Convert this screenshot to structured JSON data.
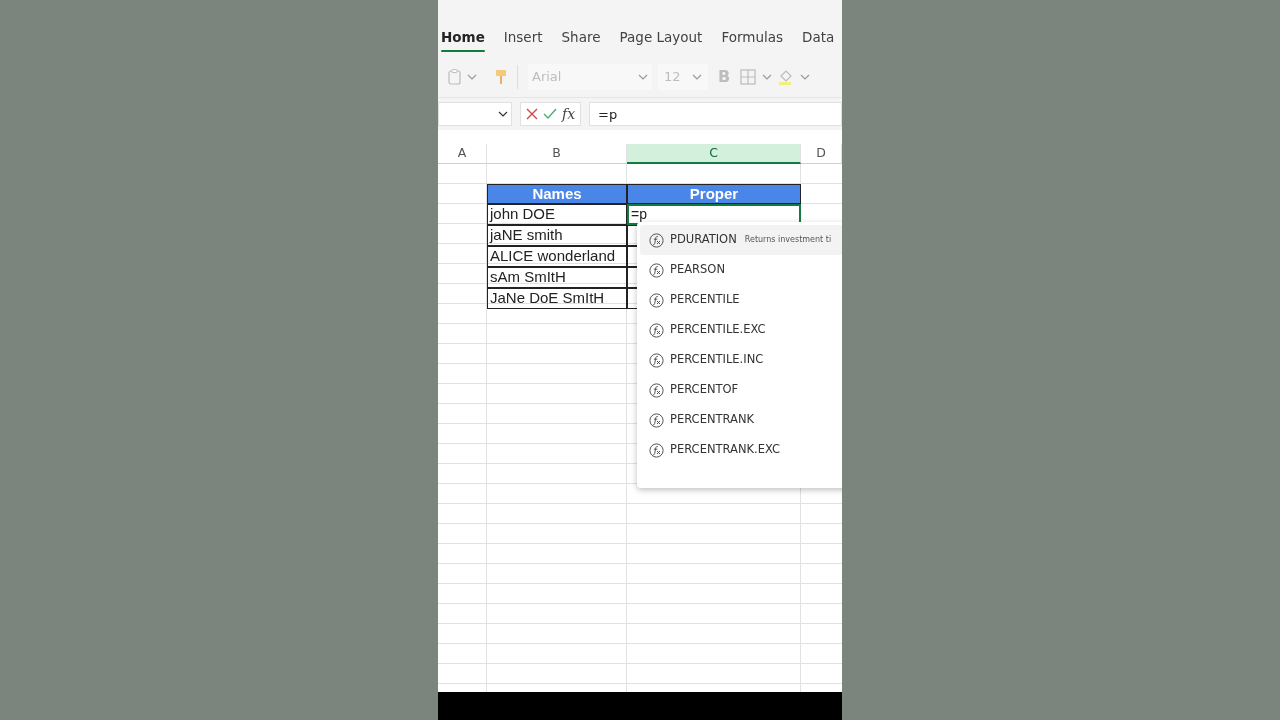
{
  "ribbon_tabs": [
    {
      "label": "Home",
      "selected": true
    },
    {
      "label": "Insert",
      "selected": false
    },
    {
      "label": "Share",
      "selected": false
    },
    {
      "label": "Page Layout",
      "selected": false
    },
    {
      "label": "Formulas",
      "selected": false
    },
    {
      "label": "Data",
      "selected": false
    }
  ],
  "toolbar": {
    "font": "Arial",
    "font_size": "12",
    "bold_label": "B"
  },
  "formula_bar": {
    "function_label": "fx",
    "value": "=p"
  },
  "columns": [
    {
      "label": "A",
      "selected": false
    },
    {
      "label": "B",
      "selected": false
    },
    {
      "label": "C",
      "selected": true
    },
    {
      "label": "D",
      "selected": false
    }
  ],
  "table": {
    "headers": [
      "Names",
      "Proper"
    ],
    "rows": [
      {
        "name": "john DOE",
        "proper": "=p",
        "active": true
      },
      {
        "name": "jaNE smith",
        "active": false
      },
      {
        "name": "ALICE wonderland",
        "active": false
      },
      {
        "name": "sAm SmItH",
        "active": false
      },
      {
        "name": "JaNe DoE SmItH",
        "active": false
      }
    ]
  },
  "autocomplete": [
    {
      "label": "PDURATION",
      "description": "Returns investment ti",
      "selected": true
    },
    {
      "label": "PEARSON",
      "selected": false
    },
    {
      "label": "PERCENTILE",
      "selected": false
    },
    {
      "label": "PERCENTILE.EXC",
      "selected": false
    },
    {
      "label": "PERCENTILE.INC",
      "selected": false
    },
    {
      "label": "PERCENTOF",
      "selected": false
    },
    {
      "label": "PERCENTRANK",
      "selected": false
    },
    {
      "label": "PERCENTRANK.EXC",
      "selected": false
    }
  ]
}
